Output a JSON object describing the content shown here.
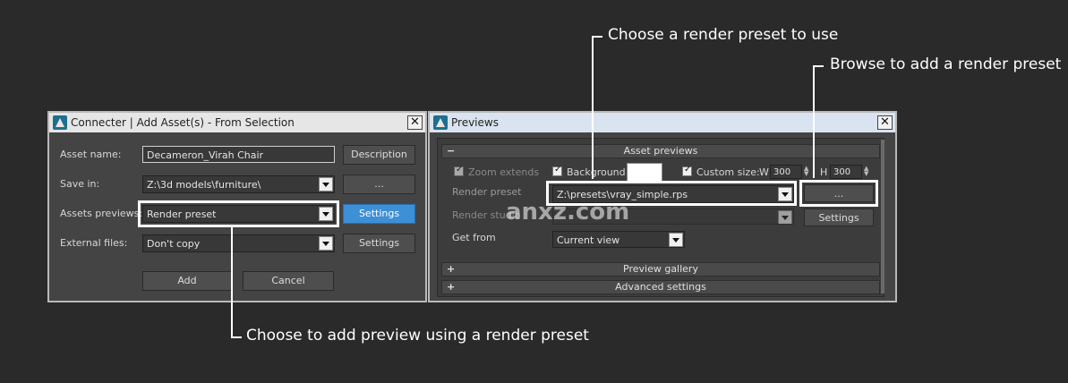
{
  "dialog1": {
    "title": "Connecter | Add Asset(s) - From Selection",
    "asset_name_label": "Asset name:",
    "asset_name_value": "Decameron_Virah Chair",
    "description_button": "Description",
    "save_in_label": "Save in:",
    "save_in_value": "Z:\\3d models\\furniture\\",
    "browse_button": "...",
    "assets_previews_label": "Assets previews:",
    "assets_previews_value": "Render preset",
    "settings_button_1": "Settings",
    "external_files_label": "External files:",
    "external_files_value": "Don't copy",
    "settings_button_2": "Settings",
    "add_button": "Add",
    "cancel_button": "Cancel"
  },
  "dialog2": {
    "title": "Previews",
    "asset_previews_header": "Asset previews",
    "asset_previews_toggle": "−",
    "zoom_extends_label": "Zoom extends",
    "background_label": "Background",
    "custom_size_label": "Custom size:",
    "w_label": "W",
    "w_value": "300",
    "h_label": "H",
    "h_value": "300",
    "render_preset_label": "Render preset",
    "render_preset_value": "Z:\\presets\\vray_simple.rps",
    "browse_button": "...",
    "render_studio_label": "Render studio",
    "settings_button": "Settings",
    "get_from_label": "Get from",
    "get_from_value": "Current view",
    "preview_gallery_header": "Preview gallery",
    "advanced_settings_header": "Advanced settings",
    "plus_toggle": "+"
  },
  "callouts": {
    "choose_preset": "Choose a render preset to use",
    "browse_preset": "Browse to add a render preset",
    "add_preview": "Choose to add preview using a render preset"
  },
  "watermark": "anxz.com"
}
